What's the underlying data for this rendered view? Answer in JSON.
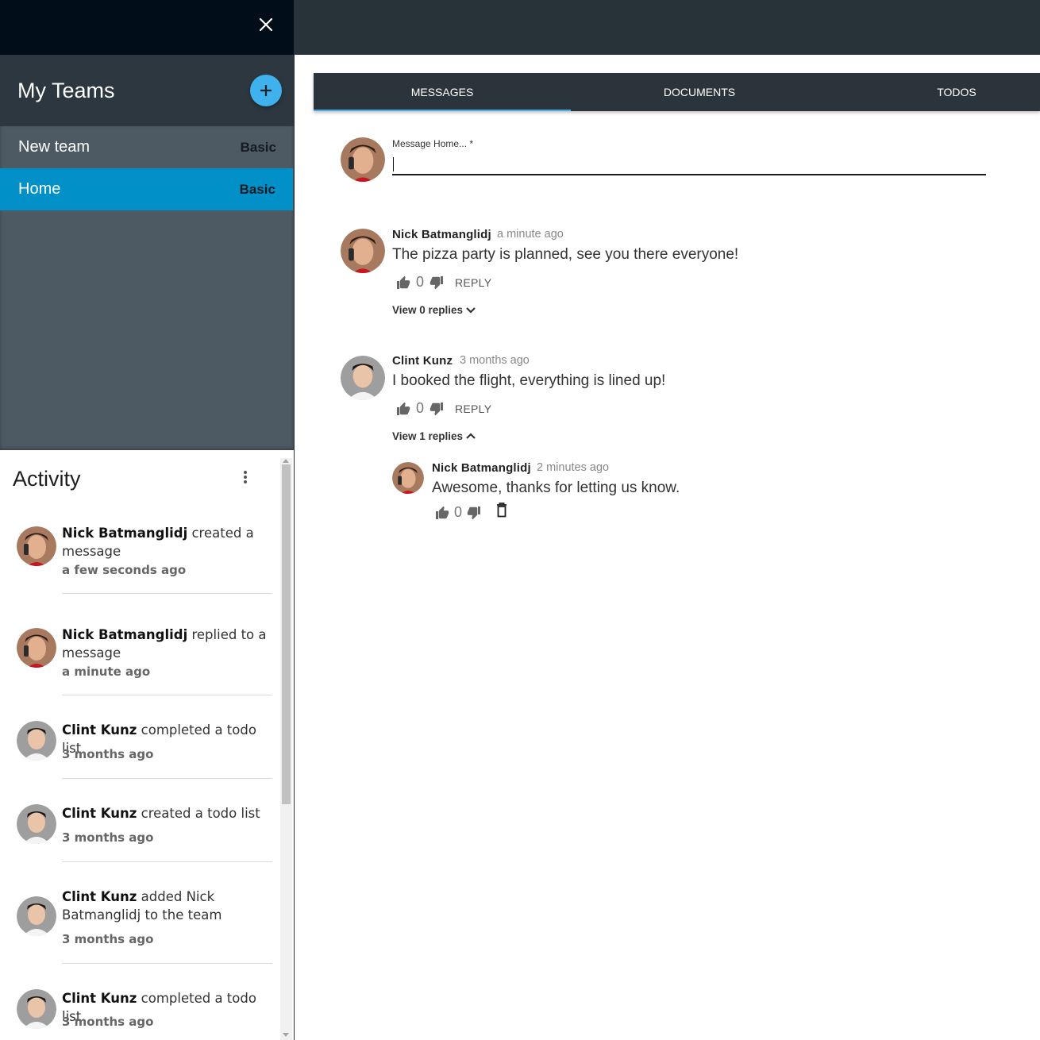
{
  "sidebar": {
    "title": "My Teams",
    "teams": [
      {
        "name": "New team",
        "plan": "Basic",
        "active": false
      },
      {
        "name": "Home",
        "plan": "Basic",
        "active": true
      }
    ]
  },
  "activity": {
    "title": "Activity",
    "items": [
      {
        "user": "Nick Batmanglidj",
        "action": " created a message",
        "time": "a few seconds ago",
        "avatar": "nick"
      },
      {
        "user": "Nick Batmanglidj",
        "action": " replied to a message",
        "time": "a minute ago",
        "avatar": "nick"
      },
      {
        "user": "Clint Kunz",
        "action": " completed a todo list",
        "time": "3 months ago",
        "avatar": "clint"
      },
      {
        "user": "Clint Kunz",
        "action": " created a todo list",
        "time": "3 months ago",
        "avatar": "clint"
      },
      {
        "user": "Clint Kunz",
        "action": " added Nick Batmanglidj to the team",
        "time": "3 months ago",
        "avatar": "clint"
      },
      {
        "user": "Clint Kunz",
        "action": " completed a todo list",
        "time": "3 months ago",
        "avatar": "clint"
      }
    ]
  },
  "tabs": [
    {
      "label": "MESSAGES",
      "active": true
    },
    {
      "label": "DOCUMENTS",
      "active": false
    },
    {
      "label": "TODOS",
      "active": false
    }
  ],
  "composer": {
    "label": "Message Home... *",
    "value": ""
  },
  "messages": [
    {
      "author": "Nick Batmanglidj",
      "time": "a minute ago",
      "body": "The pizza party is planned, see you there everyone!",
      "likes": "0",
      "reply_label": "REPLY",
      "view_replies": "View 0 replies"
    },
    {
      "author": "Clint Kunz",
      "time": "3 months ago",
      "body": "I booked the flight, everything is lined up!",
      "likes": "0",
      "reply_label": "REPLY",
      "view_replies": "View 1 replies",
      "replies": [
        {
          "author": "Nick Batmanglidj",
          "time": "2 minutes ago",
          "body": "Awesome, thanks for letting us know.",
          "likes": "0"
        }
      ]
    }
  ],
  "colors": {
    "accent": "#3fb1ec",
    "active_team": "#0290c9",
    "header": "#283239"
  }
}
